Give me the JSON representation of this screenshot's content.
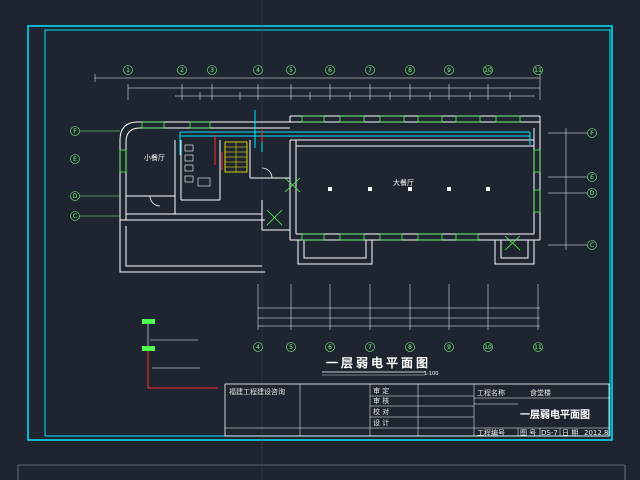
{
  "drawing": {
    "title": "一层弱电平面图",
    "scale": "1:100",
    "rooms": {
      "small_hall": "小餐厅",
      "large_hall": "大餐厅"
    },
    "colors": {
      "background": "#1e2530",
      "frame": "#00e5ff",
      "wall": "#ffffff",
      "axis": "#7dff7d",
      "window": "#4cff4c",
      "cable": "#00e5ff",
      "riser": "#ffff00",
      "legend_red": "#ff2a2a"
    },
    "axis_labels_top": [
      "1",
      "2",
      "3",
      "4",
      "5",
      "6",
      "7",
      "8",
      "9",
      "10",
      "11"
    ],
    "axis_labels_bottom": [
      "4",
      "5",
      "6",
      "7",
      "8",
      "9",
      "10",
      "11"
    ],
    "axis_labels_left": [
      "F",
      "E",
      "D",
      "C"
    ],
    "axis_labels_right": [
      "F",
      "E",
      "D",
      "C"
    ]
  },
  "title_block": {
    "company": "福建工程建设咨询",
    "drawing_name": "一层弱电平面图",
    "row_labels": [
      "审 定",
      "审 核",
      "校 对",
      "设 计"
    ],
    "project_label": "工程名称",
    "project_value": "食堂楼",
    "number_label": "工程编号",
    "sheet_label": "图 号",
    "sheet_value": "DS-7",
    "date_label": "日 期",
    "date_value": "2012.8"
  }
}
